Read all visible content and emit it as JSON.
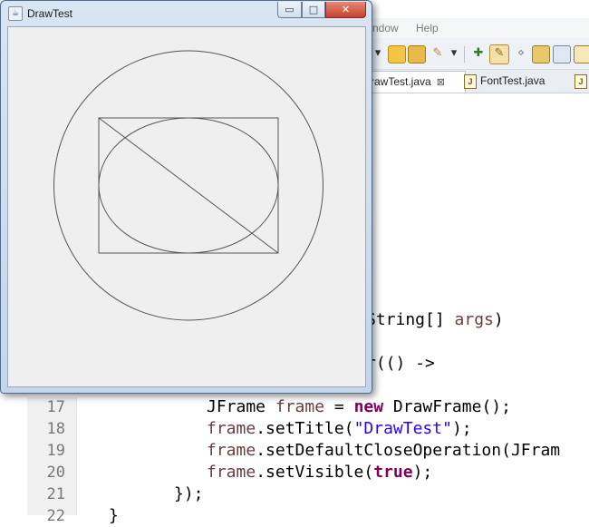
{
  "eclipse": {
    "menu": [
      "ndow",
      "Help"
    ],
    "tabs": [
      {
        "label": "rawTest.java",
        "active": true,
        "close": "⊠"
      },
      {
        "label": "FontTest.java",
        "active": false
      }
    ],
    "code": {
      "line_numbers": [
        "17",
        "18",
        "19",
        "20",
        "21",
        "22"
      ],
      "partial_1": {
        "kw_type": "String",
        "rest": "[] ",
        "var": "args",
        "close": ")"
      },
      "partial_2": "r(() ->",
      "l17": {
        "type": "JFrame ",
        "var": "frame",
        "eq": " = ",
        "kw": "new",
        "rest": " DrawFrame();"
      },
      "l18": {
        "var": "frame",
        "call": ".setTitle(",
        "str": "\"DrawTest\"",
        "end": ");"
      },
      "l19": {
        "var": "frame",
        "call": ".setDefaultCloseOperation(JFram"
      },
      "l20": {
        "var": "frame",
        "call": ".setVisible(",
        "kw": "true",
        "end": ");"
      },
      "l21": "});",
      "l22": "}"
    }
  },
  "window": {
    "title": "DrawTest",
    "icon": "java-app-icon",
    "buttons": {
      "minimize": "▭",
      "maximize": "□",
      "close": "✕"
    }
  },
  "drawing": {
    "shapes": [
      "rectangle",
      "ellipse",
      "diagonal-line",
      "circle"
    ],
    "stroke_color": "#555555"
  },
  "colors": {
    "keyword": "#7f0055",
    "string": "#2a00ff",
    "variable": "#6a3e3e",
    "window_bg": "#efefef"
  }
}
